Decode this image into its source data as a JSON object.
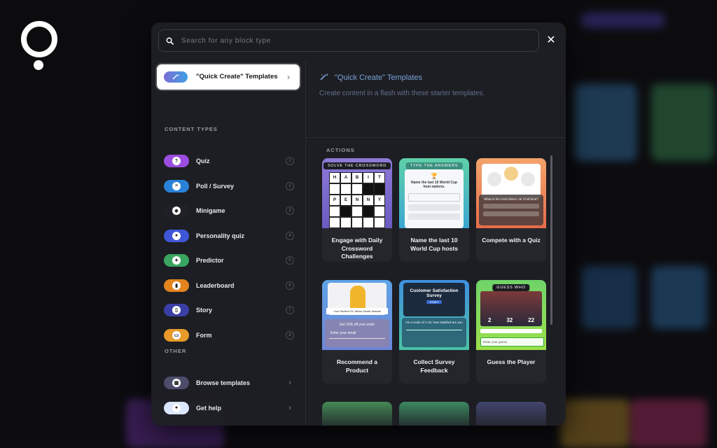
{
  "search": {
    "placeholder": "Search for any block type"
  },
  "close_label": "✕",
  "sidebar": {
    "quick_create": {
      "label": "\"Quick Create\" Templates",
      "chevron": "›"
    },
    "content_types_title": "CONTENT TYPES",
    "content_types": [
      {
        "label": "Quiz",
        "num": "1",
        "icon": "question-icon",
        "glyph": "?",
        "color": "#9b4de0"
      },
      {
        "label": "Poll / Survey",
        "num": "2",
        "icon": "list-icon",
        "glyph": "≡",
        "color": "#2a82d8"
      },
      {
        "label": "Minigame",
        "num": "3",
        "icon": "gamepad-icon",
        "glyph": "◆",
        "color": "#202128"
      },
      {
        "label": "Personality quiz",
        "num": "4",
        "icon": "person-icon",
        "glyph": "●",
        "color": "#3f57d6"
      },
      {
        "label": "Predictor",
        "num": "5",
        "icon": "medal-icon",
        "glyph": "✦",
        "color": "#3aa560"
      },
      {
        "label": "Leaderboard",
        "num": "6",
        "icon": "bar-chart-icon",
        "glyph": "▮",
        "color": "#e3841f"
      },
      {
        "label": "Story",
        "num": "7",
        "icon": "story-icon",
        "glyph": "▯",
        "color": "#3a3fa8"
      },
      {
        "label": "Form",
        "num": "8",
        "icon": "form-icon",
        "glyph": "▭",
        "color": "#e79a2a"
      }
    ],
    "other_title": "OTHER",
    "other": [
      {
        "label": "Browse templates",
        "icon": "grid-icon",
        "glyph": "▦",
        "color": "#4b4d6b",
        "chevron": "›"
      },
      {
        "label": "Get help",
        "icon": "help-bubble-icon",
        "glyph": "●",
        "color": "#dce6ff",
        "chevron": "›"
      }
    ]
  },
  "main": {
    "title": "\"Quick Create\" Templates",
    "subtitle": "Create content in a flash with these starter templates.",
    "actions_title": "ACTIONS",
    "cards": [
      {
        "caption": "Engage with Daily Crossword Challenges",
        "tag": "SOLVE THE CROSSWORD"
      },
      {
        "caption": "Name the last 10 World Cup hosts",
        "tag": "TYPE THE ANSWERS"
      },
      {
        "caption": "Compete with a Quiz",
        "tag": ""
      },
      {
        "caption": "Recommend a Product",
        "tag": ""
      },
      {
        "caption": "Collect Survey Feedback",
        "tag": ""
      },
      {
        "caption": "Guess the Player",
        "tag": "GUESS WHO"
      }
    ],
    "thumb_text": {
      "wc_question": "Name the last 10 World Cup host nations.",
      "quiz_question": "What is the most driven car of all time?",
      "product_heading": "Your Perfect Fit: Yellow Zenith Sweats",
      "product_discount": "Get 10% off your order",
      "product_email": "Enter your email",
      "survey_title": "Customer Satisfaction Survey",
      "survey_start": "START",
      "survey_question": "On a scale of 1-10, how satisfied are you",
      "player_stats": [
        "2",
        "32",
        "22"
      ],
      "player_guess": "Enter your guess"
    }
  },
  "crossword": [
    [
      "H",
      "A",
      "B",
      "I",
      "T"
    ],
    [
      "",
      "",
      "",
      "",
      ""
    ],
    [
      "P",
      "E",
      "N",
      "N",
      "Y"
    ],
    [
      "",
      "",
      "",
      "",
      ""
    ],
    [
      "",
      "",
      "",
      "",
      ""
    ]
  ]
}
